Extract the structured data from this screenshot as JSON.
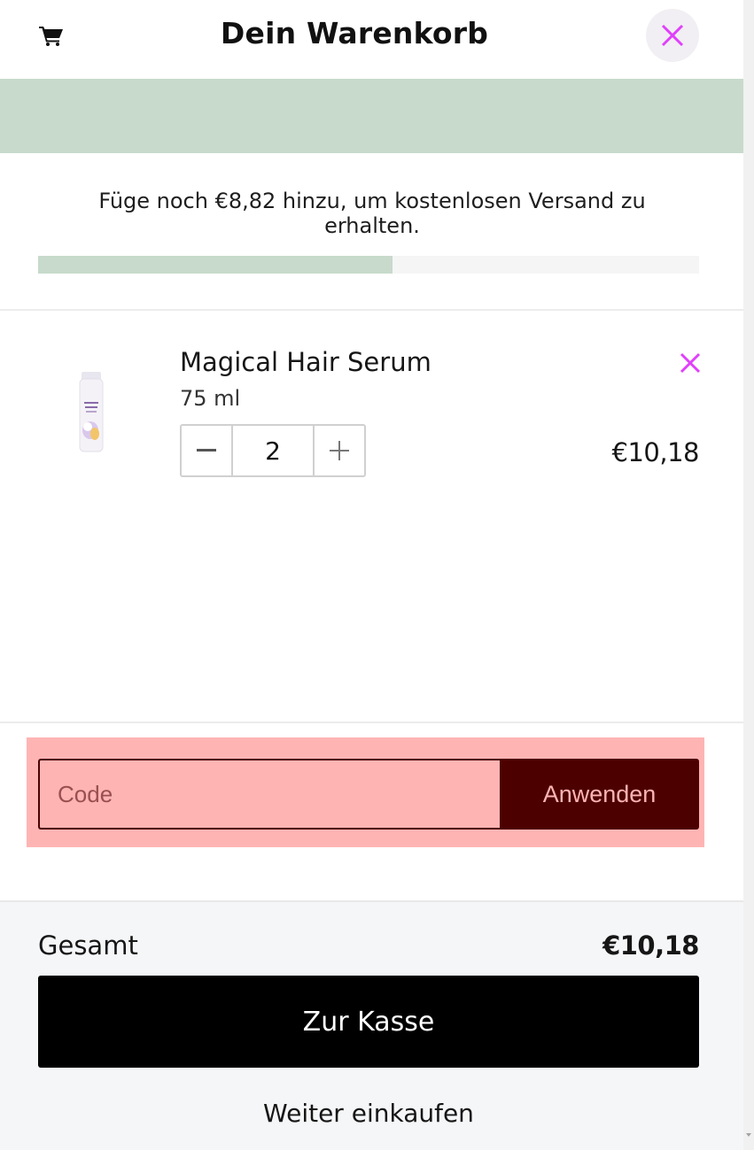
{
  "header": {
    "title": "Dein Warenkorb",
    "cart_icon": "shopping-cart-icon",
    "close_icon": "close-icon"
  },
  "shipping": {
    "message": "Füge noch €8,82 hinzu, um kostenlosen Versand zu erhalten.",
    "progress_fraction": 0.536
  },
  "item": {
    "name": "Magical Hair Serum",
    "variant": "75 ml",
    "quantity": "2",
    "price": "€10,18",
    "remove_icon": "close-icon",
    "minus_icon": "minus-icon",
    "plus_icon": "plus-icon"
  },
  "discount": {
    "placeholder": "Code",
    "apply_label": "Anwenden"
  },
  "summary": {
    "total_label": "Gesamt",
    "total_value": "€10,18",
    "checkout_label": "Zur Kasse",
    "continue_label": "Weiter einkaufen"
  },
  "colors": {
    "accent": "#e040fb",
    "banner": "#c7dacb",
    "discount_bg": "#ffb4b4",
    "discount_dark": "#4d0000",
    "checkout_bg": "#000000"
  }
}
